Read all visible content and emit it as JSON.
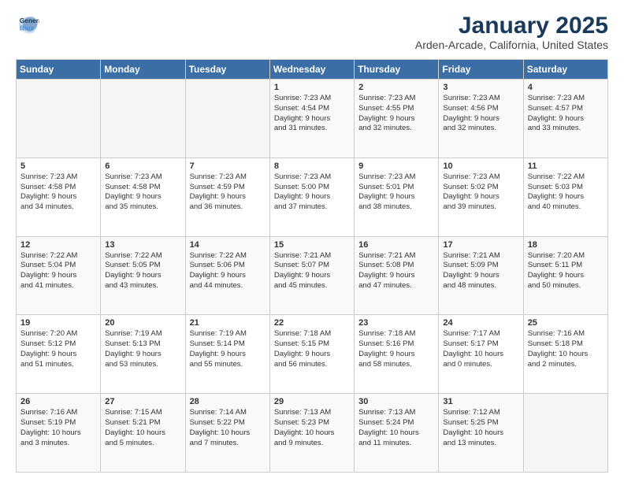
{
  "header": {
    "logo_line1": "General",
    "logo_line2": "Blue",
    "main_title": "January 2025",
    "sub_title": "Arden-Arcade, California, United States"
  },
  "weekdays": [
    "Sunday",
    "Monday",
    "Tuesday",
    "Wednesday",
    "Thursday",
    "Friday",
    "Saturday"
  ],
  "weeks": [
    [
      {
        "day": "",
        "info": ""
      },
      {
        "day": "",
        "info": ""
      },
      {
        "day": "",
        "info": ""
      },
      {
        "day": "1",
        "info": "Sunrise: 7:23 AM\nSunset: 4:54 PM\nDaylight: 9 hours\nand 31 minutes."
      },
      {
        "day": "2",
        "info": "Sunrise: 7:23 AM\nSunset: 4:55 PM\nDaylight: 9 hours\nand 32 minutes."
      },
      {
        "day": "3",
        "info": "Sunrise: 7:23 AM\nSunset: 4:56 PM\nDaylight: 9 hours\nand 32 minutes."
      },
      {
        "day": "4",
        "info": "Sunrise: 7:23 AM\nSunset: 4:57 PM\nDaylight: 9 hours\nand 33 minutes."
      }
    ],
    [
      {
        "day": "5",
        "info": "Sunrise: 7:23 AM\nSunset: 4:58 PM\nDaylight: 9 hours\nand 34 minutes."
      },
      {
        "day": "6",
        "info": "Sunrise: 7:23 AM\nSunset: 4:58 PM\nDaylight: 9 hours\nand 35 minutes."
      },
      {
        "day": "7",
        "info": "Sunrise: 7:23 AM\nSunset: 4:59 PM\nDaylight: 9 hours\nand 36 minutes."
      },
      {
        "day": "8",
        "info": "Sunrise: 7:23 AM\nSunset: 5:00 PM\nDaylight: 9 hours\nand 37 minutes."
      },
      {
        "day": "9",
        "info": "Sunrise: 7:23 AM\nSunset: 5:01 PM\nDaylight: 9 hours\nand 38 minutes."
      },
      {
        "day": "10",
        "info": "Sunrise: 7:23 AM\nSunset: 5:02 PM\nDaylight: 9 hours\nand 39 minutes."
      },
      {
        "day": "11",
        "info": "Sunrise: 7:22 AM\nSunset: 5:03 PM\nDaylight: 9 hours\nand 40 minutes."
      }
    ],
    [
      {
        "day": "12",
        "info": "Sunrise: 7:22 AM\nSunset: 5:04 PM\nDaylight: 9 hours\nand 41 minutes."
      },
      {
        "day": "13",
        "info": "Sunrise: 7:22 AM\nSunset: 5:05 PM\nDaylight: 9 hours\nand 43 minutes."
      },
      {
        "day": "14",
        "info": "Sunrise: 7:22 AM\nSunset: 5:06 PM\nDaylight: 9 hours\nand 44 minutes."
      },
      {
        "day": "15",
        "info": "Sunrise: 7:21 AM\nSunset: 5:07 PM\nDaylight: 9 hours\nand 45 minutes."
      },
      {
        "day": "16",
        "info": "Sunrise: 7:21 AM\nSunset: 5:08 PM\nDaylight: 9 hours\nand 47 minutes."
      },
      {
        "day": "17",
        "info": "Sunrise: 7:21 AM\nSunset: 5:09 PM\nDaylight: 9 hours\nand 48 minutes."
      },
      {
        "day": "18",
        "info": "Sunrise: 7:20 AM\nSunset: 5:11 PM\nDaylight: 9 hours\nand 50 minutes."
      }
    ],
    [
      {
        "day": "19",
        "info": "Sunrise: 7:20 AM\nSunset: 5:12 PM\nDaylight: 9 hours\nand 51 minutes."
      },
      {
        "day": "20",
        "info": "Sunrise: 7:19 AM\nSunset: 5:13 PM\nDaylight: 9 hours\nand 53 minutes."
      },
      {
        "day": "21",
        "info": "Sunrise: 7:19 AM\nSunset: 5:14 PM\nDaylight: 9 hours\nand 55 minutes."
      },
      {
        "day": "22",
        "info": "Sunrise: 7:18 AM\nSunset: 5:15 PM\nDaylight: 9 hours\nand 56 minutes."
      },
      {
        "day": "23",
        "info": "Sunrise: 7:18 AM\nSunset: 5:16 PM\nDaylight: 9 hours\nand 58 minutes."
      },
      {
        "day": "24",
        "info": "Sunrise: 7:17 AM\nSunset: 5:17 PM\nDaylight: 10 hours\nand 0 minutes."
      },
      {
        "day": "25",
        "info": "Sunrise: 7:16 AM\nSunset: 5:18 PM\nDaylight: 10 hours\nand 2 minutes."
      }
    ],
    [
      {
        "day": "26",
        "info": "Sunrise: 7:16 AM\nSunset: 5:19 PM\nDaylight: 10 hours\nand 3 minutes."
      },
      {
        "day": "27",
        "info": "Sunrise: 7:15 AM\nSunset: 5:21 PM\nDaylight: 10 hours\nand 5 minutes."
      },
      {
        "day": "28",
        "info": "Sunrise: 7:14 AM\nSunset: 5:22 PM\nDaylight: 10 hours\nand 7 minutes."
      },
      {
        "day": "29",
        "info": "Sunrise: 7:13 AM\nSunset: 5:23 PM\nDaylight: 10 hours\nand 9 minutes."
      },
      {
        "day": "30",
        "info": "Sunrise: 7:13 AM\nSunset: 5:24 PM\nDaylight: 10 hours\nand 11 minutes."
      },
      {
        "day": "31",
        "info": "Sunrise: 7:12 AM\nSunset: 5:25 PM\nDaylight: 10 hours\nand 13 minutes."
      },
      {
        "day": "",
        "info": ""
      }
    ]
  ]
}
